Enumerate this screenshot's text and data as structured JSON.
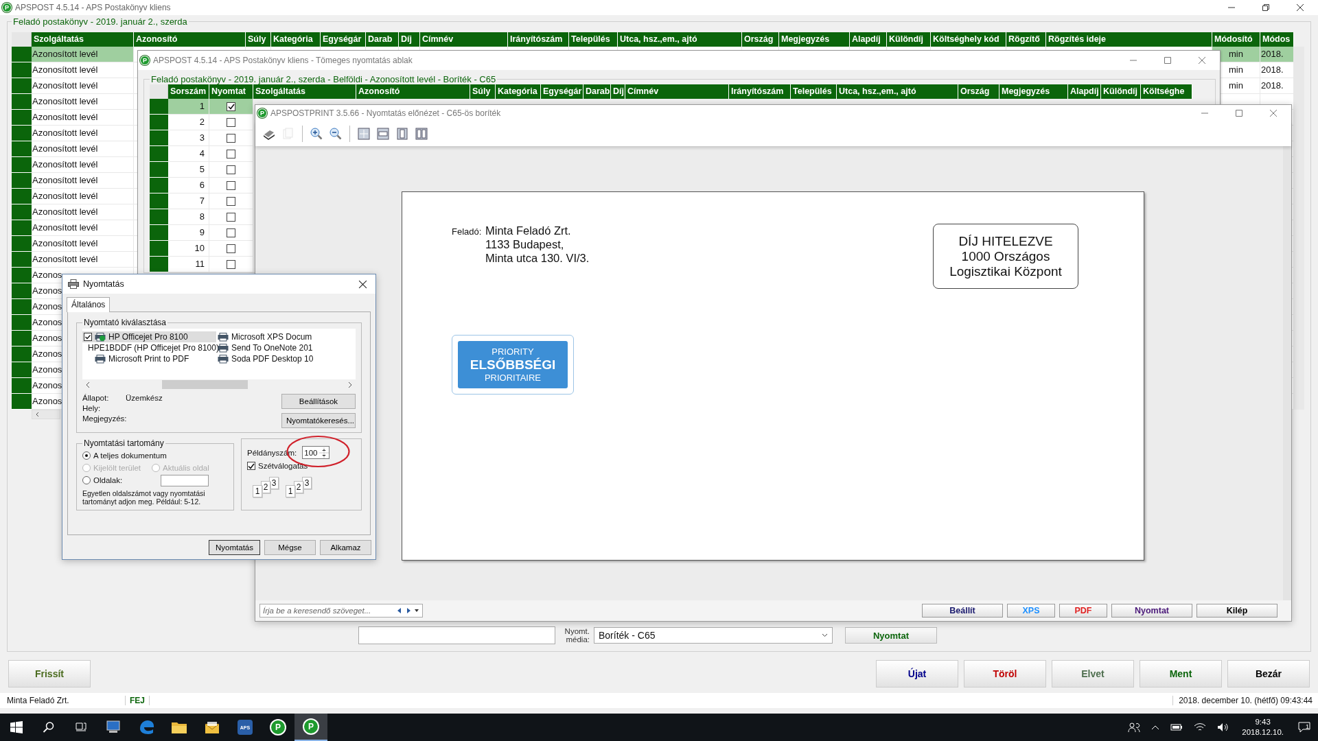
{
  "main_window": {
    "icon_letter": "P",
    "title": "APSPOST 4.5.14 - APS Postakönyv kliens",
    "group_title": "Feladó postakönyv - 2019. január 2., szerda",
    "grid": {
      "columns": [
        "Szolgáltatás",
        "Azonosító",
        "Súly",
        "Kategória",
        "Egységár",
        "Darab",
        "Díj",
        "Címnév",
        "Irányítószám",
        "Település",
        "Utca, hsz.,em., ajtó",
        "Ország",
        "Megjegyzés",
        "Alapdíj",
        "Különdíj",
        "Költséghely kód",
        "Rögzítő",
        "Rögzítés ideje",
        "Módosító",
        "Módos"
      ],
      "rows": [
        {
          "selected": true,
          "service": "Azonosított levél",
          "modifier": "min",
          "modified": "2018."
        },
        {
          "selected": false,
          "service": "Azonosított levél",
          "modifier": "min",
          "modified": "2018."
        },
        {
          "selected": false,
          "service": "Azonosított levél",
          "modifier": "min",
          "modified": "2018."
        },
        {
          "selected": false,
          "service": "Azonosított levél"
        },
        {
          "selected": false,
          "service": "Azonosított levél"
        },
        {
          "selected": false,
          "service": "Azonosított levél"
        },
        {
          "selected": false,
          "service": "Azonosított levél"
        },
        {
          "selected": false,
          "service": "Azonosított levél"
        },
        {
          "selected": false,
          "service": "Azonosított levél"
        },
        {
          "selected": false,
          "service": "Azonosított levél"
        },
        {
          "selected": false,
          "service": "Azonosított levél"
        },
        {
          "selected": false,
          "service": "Azonosított levél"
        },
        {
          "selected": false,
          "service": "Azonosított levél"
        },
        {
          "selected": false,
          "service": "Azonosított levél"
        },
        {
          "selected": false,
          "service": "Azonos"
        },
        {
          "selected": false,
          "service": "Azonos"
        },
        {
          "selected": false,
          "service": "Azonos"
        },
        {
          "selected": false,
          "service": "Azonos"
        },
        {
          "selected": false,
          "service": "Azonos"
        },
        {
          "selected": false,
          "service": "Azonos"
        },
        {
          "selected": false,
          "service": "Azonos"
        },
        {
          "selected": false,
          "service": "Azonos"
        },
        {
          "selected": false,
          "service": "Azonos"
        }
      ]
    },
    "media_label": "Nyomt. média:",
    "media_value": "Boríték - C65",
    "print_button": "Nyomtat",
    "refresh_button": {
      "label": "Frissít",
      "color": "#4a6b1e"
    },
    "action_buttons": [
      {
        "label": "Újat",
        "color": "#00008b"
      },
      {
        "label": "Töröl",
        "color": "#c00000"
      },
      {
        "label": "Elvet",
        "color": "#4f6f4f"
      },
      {
        "label": "Ment",
        "color": "#0b650b"
      },
      {
        "label": "Bezár",
        "color": "#000000"
      }
    ]
  },
  "status_bar": {
    "user": "Minta Feladó Zrt.",
    "mode": "FEJ",
    "datetime": "2018. december 10. (hétfő) 09:43:44"
  },
  "mass_print_window": {
    "icon_letter": "P",
    "title": "APSPOST 4.5.14 - APS Postakönyv kliens - Tömeges nyomtatás ablak",
    "group_title": "Feladó postakönyv - 2019. január 2., szerda - Belföldi - Azonosított levél - Boríték - C65",
    "columns": [
      "Sorszám",
      "Nyomtat",
      "Szolgáltatás",
      "Azonosító",
      "Súly",
      "Kategória",
      "Egységár",
      "Darab",
      "Díj",
      "Címnév",
      "Irányítószám",
      "Település",
      "Utca, hsz.,em., ajtó",
      "Ország",
      "Megjegyzés",
      "Alapdíj",
      "Különdíj",
      "Költséghe"
    ],
    "rows": [
      {
        "number": "1",
        "print": true,
        "selected": true
      },
      {
        "number": "2",
        "print": false,
        "selected": false
      },
      {
        "number": "3",
        "print": false,
        "selected": false
      },
      {
        "number": "4",
        "print": false,
        "selected": false
      },
      {
        "number": "5",
        "print": false,
        "selected": false
      },
      {
        "number": "6",
        "print": false,
        "selected": false
      },
      {
        "number": "7",
        "print": false,
        "selected": false
      },
      {
        "number": "8",
        "print": false,
        "selected": false
      },
      {
        "number": "9",
        "print": false,
        "selected": false
      },
      {
        "number": "10",
        "print": false,
        "selected": false
      },
      {
        "number": "11",
        "print": false,
        "selected": false
      }
    ]
  },
  "preview_window": {
    "icon_letter": "P",
    "title": "APSPOSTPRINT 3.5.66 - Nyomtatás előnézet - C65-ös boríték",
    "toolbar": [
      [
        {
          "kind": "print",
          "disabled": false
        },
        {
          "kind": "copy",
          "disabled": true
        }
      ],
      [
        {
          "kind": "zoom_in",
          "disabled": false
        },
        {
          "kind": "zoom_out",
          "disabled": false
        }
      ],
      [
        {
          "kind": "fit_page",
          "disabled": false
        },
        {
          "kind": "fit_width",
          "disabled": false
        },
        {
          "kind": "single_page",
          "disabled": false
        },
        {
          "kind": "two_pages",
          "disabled": false
        }
      ]
    ],
    "envelope": {
      "sender_label": "Feladó:",
      "sender_lines": [
        "Minta Feladó Zrt.",
        "1133 Budapest,",
        "Minta utca 130. VI/3."
      ],
      "postage_lines": [
        "DÍJ HITELEZVE",
        "1000 Országos",
        "Logisztikai Központ"
      ],
      "priority_lines": [
        "PRIORITY",
        "ELSŐBBSÉGI",
        "PRIORITAIRE"
      ]
    },
    "search_placeholder": "Írja be a keresendő szöveget...",
    "buttons": [
      {
        "label": "Beállít",
        "color": "#1a1a6e"
      },
      {
        "label": "XPS",
        "color": "#1e90ff"
      },
      {
        "label": "PDF",
        "color": "#e02020"
      },
      {
        "label": "Nyomtat",
        "color": "#4b1a7a"
      },
      {
        "label": "Kilép",
        "color": "#000000"
      }
    ]
  },
  "print_dialog": {
    "title": "Nyomtatás",
    "tabs": [
      {
        "label": "Általános",
        "selected": true
      }
    ],
    "printer_group": "Nyomtató kiválasztása",
    "printers": [
      {
        "name": "HP Officejet Pro 8100",
        "default": true,
        "selected": true
      },
      {
        "name": "HPE1BDDF (HP Officejet Pro 8100)",
        "default": false,
        "selected": false
      },
      {
        "name": "Microsoft Print to PDF",
        "default": false,
        "selected": false
      },
      {
        "name": "Microsoft XPS Docum",
        "default": false,
        "selected": false
      },
      {
        "name": "Send To OneNote 201",
        "default": false,
        "selected": false
      },
      {
        "name": "Soda PDF Desktop 10",
        "default": false,
        "selected": false
      }
    ],
    "info": [
      {
        "label": "Állapot:",
        "value": "Üzemkész"
      },
      {
        "label": "Hely:"
      },
      {
        "label": "Megjegyzés:"
      }
    ],
    "settings_button": "Beállítások",
    "find_button": "Nyomtatókeresés...",
    "range_group": "Nyomtatási tartomány",
    "range_rows": [
      [
        {
          "kind": "radio",
          "label": "A teljes dokumentum",
          "selected": true,
          "disabled": false
        }
      ],
      [
        {
          "kind": "radio",
          "label": "Kijelölt terület",
          "selected": false,
          "disabled": true
        },
        {
          "kind": "radio",
          "label": "Aktuális oldal",
          "selected": false,
          "disabled": true
        }
      ],
      [
        {
          "kind": "radio_field",
          "label": "Oldalak:",
          "selected": false,
          "disabled": false
        }
      ]
    ],
    "range_help": "Egyetlen oldalszámot vagy nyomtatási tartományt adjon meg. Például: 5-12.",
    "copies_label": "Példányszám:",
    "copies_value": "100",
    "collate_label": "Szétválogatás",
    "collate": true,
    "collate_icons": [
      [
        "1",
        "2",
        "3"
      ],
      [
        "1",
        "2",
        "3"
      ]
    ],
    "buttons": [
      "Nyomtatás",
      "Mégse",
      "Alkamaz"
    ]
  },
  "taskbar": {
    "apps": [
      {
        "kind": "computer",
        "active": false
      },
      {
        "kind": "edge",
        "active": false
      },
      {
        "kind": "folder",
        "active": false
      },
      {
        "kind": "mail",
        "active": false
      },
      {
        "kind": "aps",
        "label": "APS",
        "active": false
      },
      {
        "kind": "p",
        "label": "P",
        "active": false
      },
      {
        "kind": "p",
        "label": "P",
        "active": true
      }
    ],
    "time": "9:43",
    "date": "2018.12.10.",
    "notifications": "1"
  }
}
